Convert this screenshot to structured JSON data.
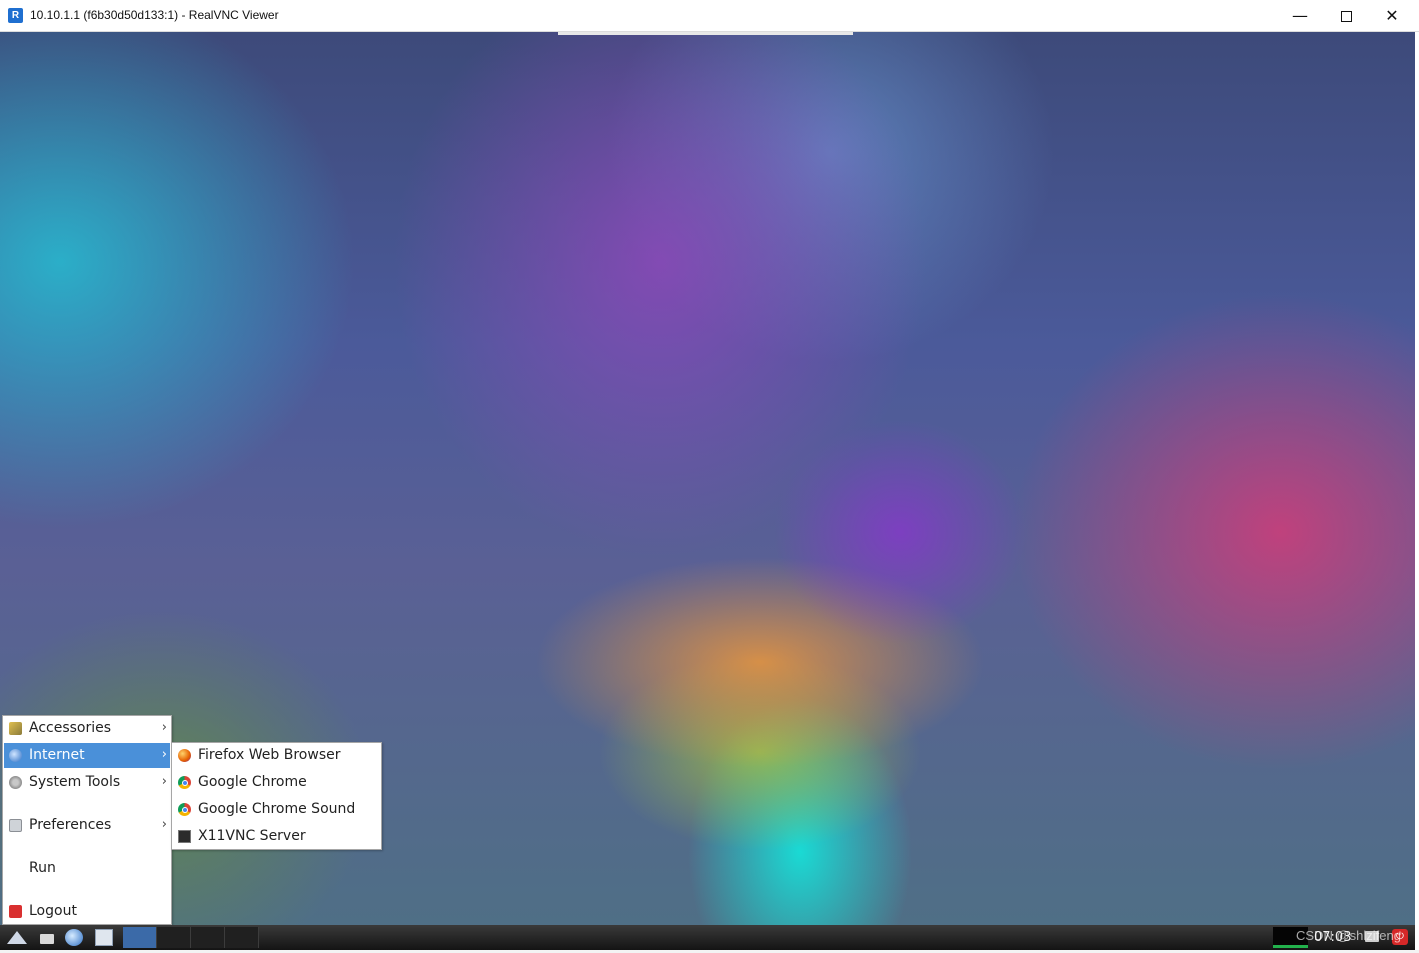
{
  "window": {
    "title": "10.10.1.1 (f6b30d50d133:1) - RealVNC Viewer",
    "app_icon_glyph": "R",
    "minimize_glyph": "—",
    "close_glyph": "✕"
  },
  "start_menu": {
    "items": [
      {
        "label": "Accessories",
        "icon": "accessories-icon",
        "submenu": true
      },
      {
        "label": "Internet",
        "icon": "internet-globe-icon",
        "submenu": true,
        "selected": true
      },
      {
        "label": "System Tools",
        "icon": "system-tools-icon",
        "submenu": true
      },
      {
        "label": "Preferences",
        "icon": "preferences-icon",
        "submenu": true
      },
      {
        "label": "Run",
        "icon": null,
        "submenu": false
      },
      {
        "label": "Logout",
        "icon": "logout-icon",
        "submenu": false
      }
    ],
    "submenu_arrow": "›"
  },
  "internet_submenu": {
    "items": [
      {
        "label": "Firefox Web Browser",
        "icon": "firefox-icon"
      },
      {
        "label": "Google Chrome",
        "icon": "chrome-icon"
      },
      {
        "label": "Google Chrome Sound",
        "icon": "chrome-icon"
      },
      {
        "label": "X11VNC Server",
        "icon": "monitor-icon"
      }
    ]
  },
  "taskbar": {
    "clock": "07:03",
    "power_glyph": "⏻",
    "watermark": "CSDN @shlzifeng"
  },
  "colors": {
    "menu_selection": "#4a90d9",
    "taskbar": "#1f1f1f",
    "power_button": "#d62828"
  }
}
